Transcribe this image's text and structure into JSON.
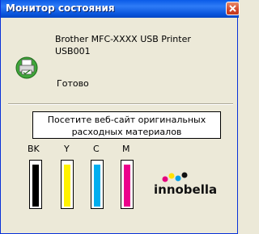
{
  "window": {
    "title": "Монитор состояния"
  },
  "printer": {
    "model": "Brother MFC-XXXX USB Printer",
    "port": "USB001",
    "status": "Готово",
    "icon": "printer-ok-icon"
  },
  "supplies_button": {
    "line1": "Посетите веб-сайт оригинальных",
    "line2": "расходных материалов"
  },
  "ink": [
    {
      "label": "BK",
      "level": 0.95,
      "color": "#000000"
    },
    {
      "label": "Y",
      "level": 0.95,
      "color": "#FFF200"
    },
    {
      "label": "C",
      "level": 0.95,
      "color": "#00AEEF"
    },
    {
      "label": "M",
      "level": 0.95,
      "color": "#EC008C"
    }
  ],
  "brand": {
    "logo_text": "innobella"
  }
}
